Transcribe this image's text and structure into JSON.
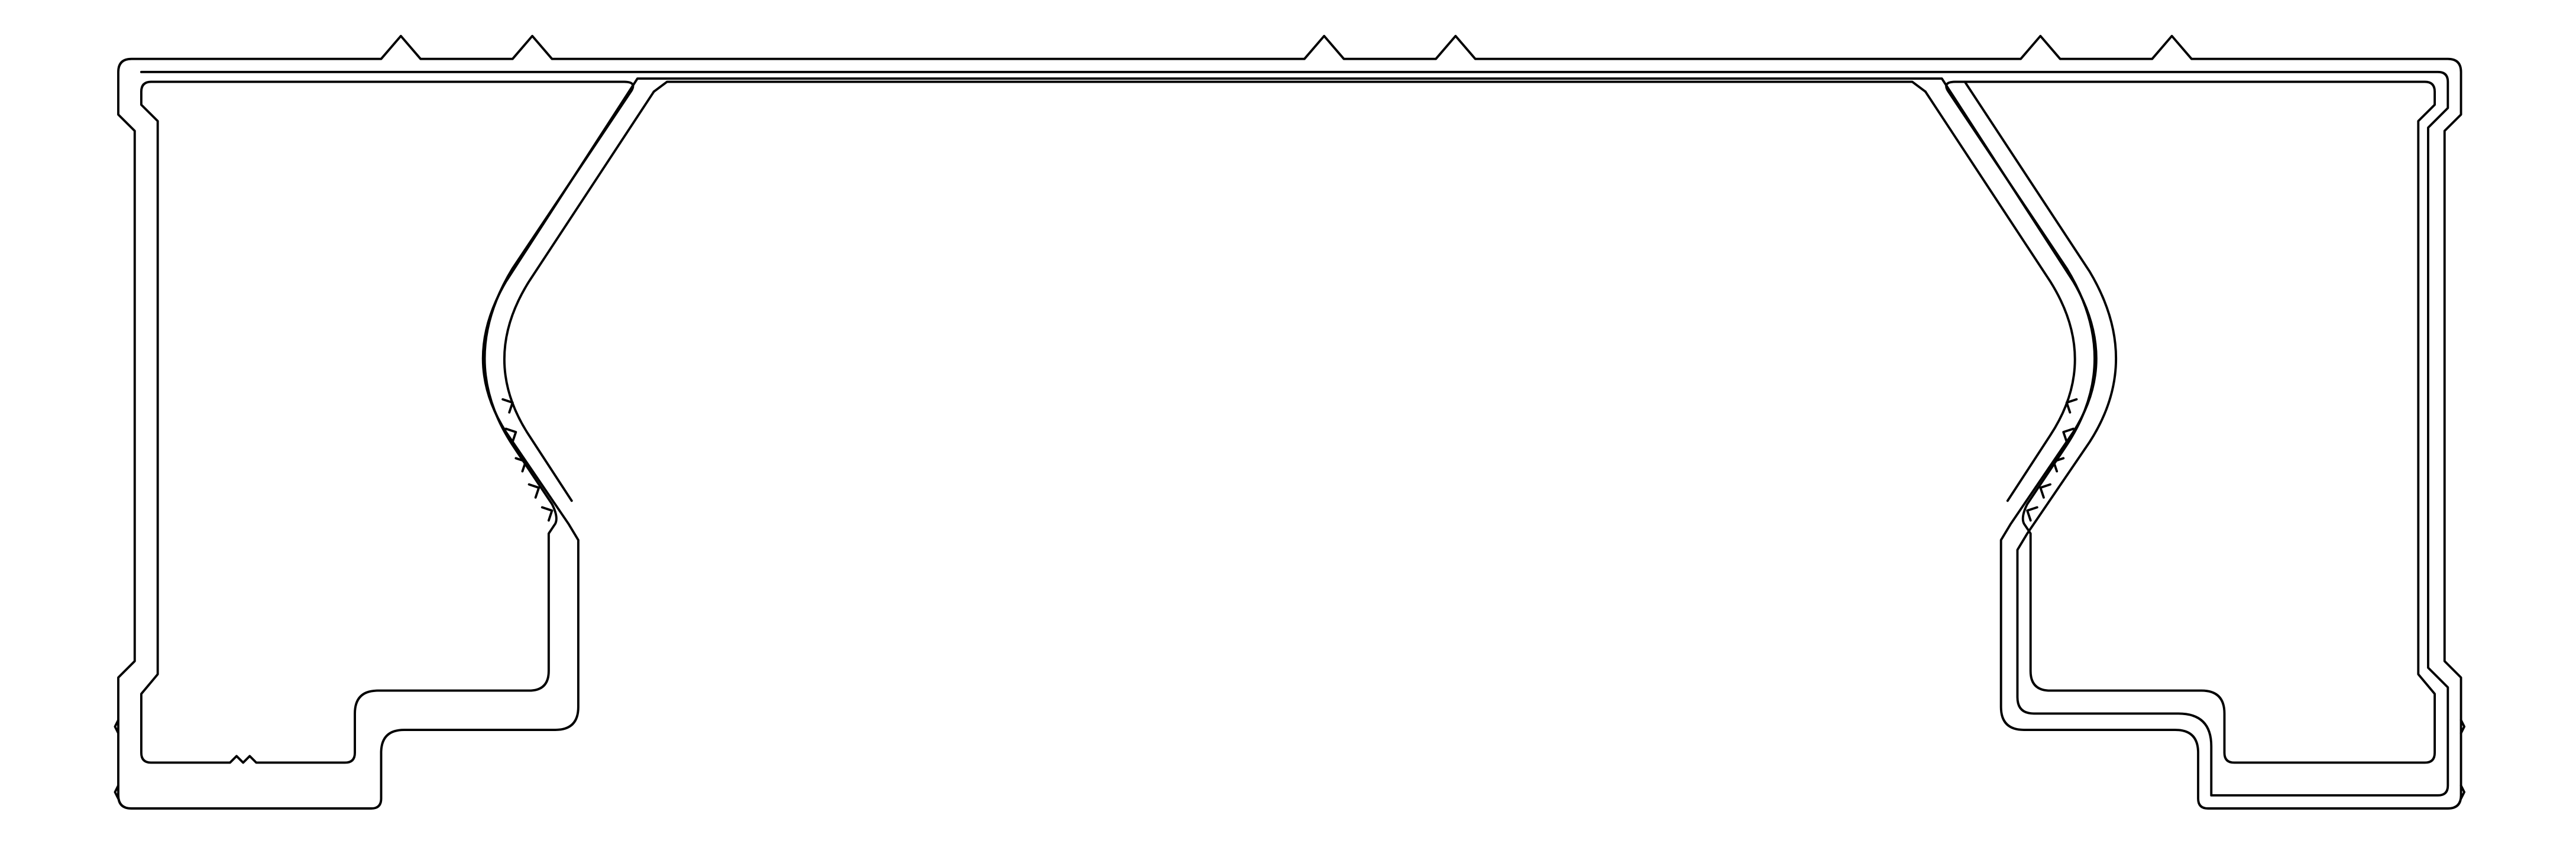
{
  "drawing": {
    "title": "",
    "stroke_color": "#000000",
    "background_color": "#ffffff"
  }
}
